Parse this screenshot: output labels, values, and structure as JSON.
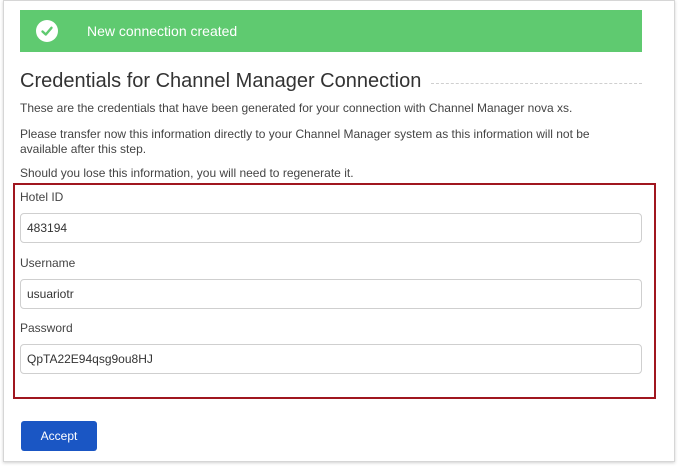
{
  "toast": {
    "icon": "check-circle-icon",
    "message": "New connection created",
    "color": "#5fca70"
  },
  "heading": "Credentials for Channel Manager Connection",
  "paragraphs": [
    "These are the credentials that have been generated for your connection with Channel Manager nova xs.",
    "Please transfer now this information directly to your Channel Manager system as this information will not be available after this step.",
    "Should you lose this information, you will need to regenerate it."
  ],
  "fields": [
    {
      "label": "Hotel ID",
      "value": "483194"
    },
    {
      "label": "Username",
      "value": "usuariotr"
    },
    {
      "label": "Password",
      "value": "QpTA22E94qsg9ou8HJ"
    }
  ],
  "highlight_color": "#a0161f",
  "accept_button": {
    "label": "Accept",
    "color": "#1a56c4"
  }
}
